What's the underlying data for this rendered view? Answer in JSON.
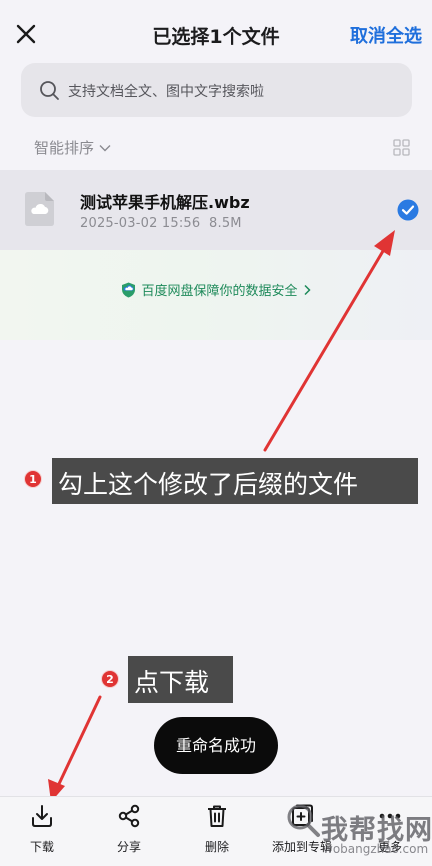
{
  "header": {
    "title": "已选择1个文件",
    "cancel_all_label": "取消全选",
    "close_icon": "close-icon"
  },
  "search": {
    "placeholder": "支持文档全文、图中文字搜索啦",
    "icon": "search-icon"
  },
  "sort": {
    "label": "智能排序",
    "icon": "chevron-down-icon",
    "view_toggle_icon": "grid-view-icon"
  },
  "files": [
    {
      "name": "测试苹果手机解压.wbz",
      "date": "2025-03-02 15:56",
      "size": "8.5M",
      "selected": true,
      "icon": "cloud-file-icon"
    }
  ],
  "banner": {
    "text": "百度网盘保障你的数据安全",
    "icon": "shield-icon"
  },
  "annotations": [
    {
      "number": "1",
      "text": "勾上这个修改了后缀的文件"
    },
    {
      "number": "2",
      "text": "点下载"
    }
  ],
  "toast": {
    "text": "重命名成功"
  },
  "toolbar": {
    "items": [
      {
        "label": "下载",
        "icon": "download-icon"
      },
      {
        "label": "分享",
        "icon": "share-icon"
      },
      {
        "label": "删除",
        "icon": "trash-icon"
      },
      {
        "label": "添加到专辑",
        "icon": "add-to-album-icon"
      },
      {
        "label": "更多",
        "icon": "more-icon"
      }
    ]
  },
  "watermark": {
    "text": "我帮找网",
    "subtext": "wobangzhao.com"
  },
  "colors": {
    "accent_blue": "#1f6fdc",
    "check_blue": "#2a7ae2",
    "annotation_red": "#e03434",
    "banner_green": "#1e8a5a",
    "annotation_box": "#4a4a4a"
  }
}
